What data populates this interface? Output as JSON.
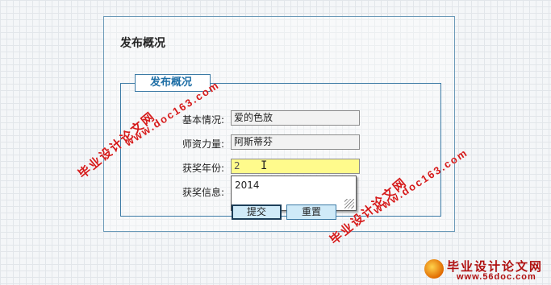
{
  "page": {
    "title": "发布概况"
  },
  "form": {
    "legend": "发布概况",
    "fields": [
      {
        "label": "基本情况:",
        "value": "爱的色放"
      },
      {
        "label": "师资力量:",
        "value": "阿斯蒂芬"
      },
      {
        "label": "获奖年份:",
        "value": "2"
      },
      {
        "label": "获奖信息:",
        "value": ""
      }
    ],
    "autocomplete": {
      "options": [
        "2014"
      ]
    },
    "buttons": {
      "submit": "提交",
      "reset": "重置"
    }
  },
  "watermarks": {
    "url": "www.doc163.com",
    "site_cn": "毕业设计论文网"
  },
  "brand": {
    "name": "毕业设计论文网",
    "url": "www.56doc.com"
  },
  "colors": {
    "accent": "#3b7aa5",
    "active_input": "#fffb8c",
    "button_bg": "#cfeaf8",
    "watermark": "#d51a1a"
  }
}
